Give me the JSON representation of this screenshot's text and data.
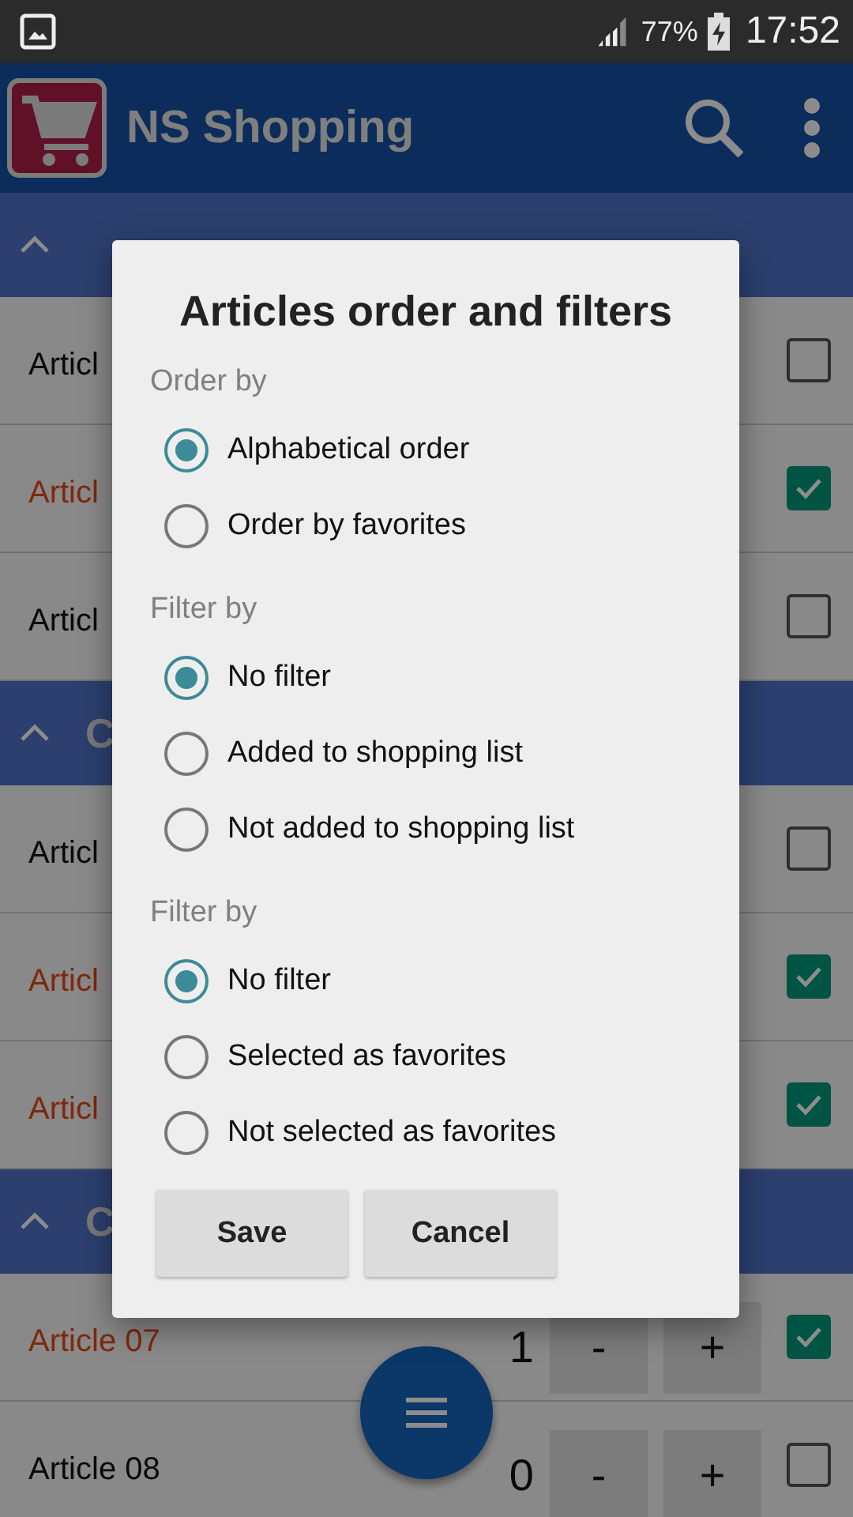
{
  "status_bar": {
    "battery": "77%",
    "time": "17:52"
  },
  "app_bar": {
    "title": "NS Shopping"
  },
  "categories": [
    {
      "expanded": true,
      "articles": [
        {
          "name": "Articl",
          "checked": false
        },
        {
          "name": "Articl",
          "checked": true
        },
        {
          "name": "Articl",
          "checked": false
        }
      ]
    },
    {
      "title": "C",
      "expanded": true,
      "articles": [
        {
          "name": "Articl",
          "checked": false
        },
        {
          "name": "Articl",
          "checked": true
        },
        {
          "name": "Articl",
          "checked": true
        }
      ]
    },
    {
      "title": "C",
      "expanded": true,
      "articles": [
        {
          "name": "Article 07",
          "checked": true,
          "quantity": "1",
          "minus": "-",
          "plus": "+"
        },
        {
          "name": "Article 08",
          "checked": false,
          "quantity": "0",
          "minus": "-",
          "plus": "+"
        }
      ]
    }
  ],
  "dialog": {
    "title": "Articles order and filters",
    "groups": [
      {
        "label": "Order by",
        "options": [
          {
            "label": "Alphabetical order",
            "selected": true
          },
          {
            "label": "Order by favorites",
            "selected": false
          }
        ]
      },
      {
        "label": "Filter by",
        "options": [
          {
            "label": "No filter",
            "selected": true
          },
          {
            "label": "Added to shopping list",
            "selected": false
          },
          {
            "label": "Not added to shopping list",
            "selected": false
          }
        ]
      },
      {
        "label": "Filter by",
        "options": [
          {
            "label": "No filter",
            "selected": true
          },
          {
            "label": "Selected as favorites",
            "selected": false
          },
          {
            "label": "Not selected as favorites",
            "selected": false
          }
        ]
      }
    ],
    "buttons": [
      "Save",
      "Cancel"
    ]
  }
}
